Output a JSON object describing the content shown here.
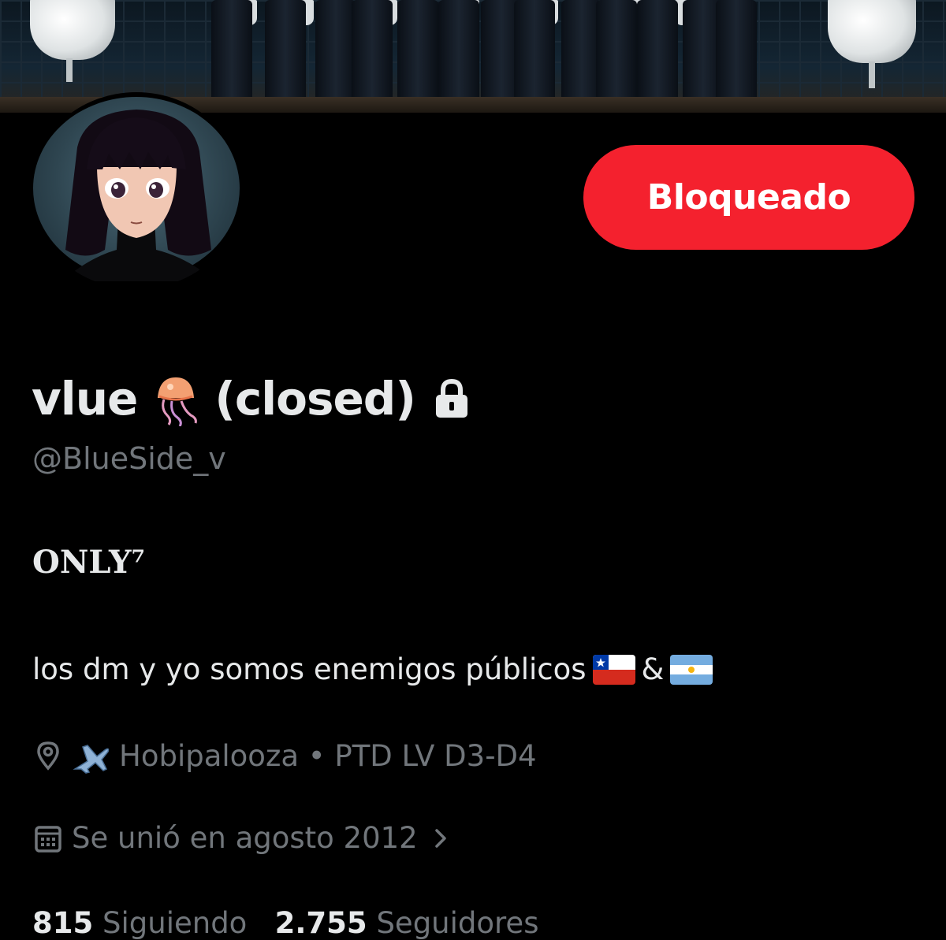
{
  "profile": {
    "display_name": "vlue",
    "display_name_suffix": "(closed)",
    "name_emoji": "jellyfish-icon",
    "handle": "@BlueSide_v",
    "bio_line1": "ONLY⁷",
    "bio_line2": "los dm y yo somos enemigos públicos",
    "bio_ampersand": "&",
    "bio_flags": [
      "chile-flag-icon",
      "argentina-flag-icon"
    ],
    "location_prefix_icon": "airplane-icon",
    "location": "Hobipalooza • PTD LV D3-D4",
    "joined": "Se unió en agosto 2012",
    "following_count": "815",
    "following_label": "Siguiendo",
    "followers_count": "2.755",
    "followers_label": "Seguidores",
    "protected_icon": "lock-icon"
  },
  "actions": {
    "blocked_label": "Bloqueado"
  },
  "colors": {
    "background": "#000000",
    "primary_text": "#e7e9ea",
    "secondary_text": "#71767b",
    "blocked_button": "#f4212e"
  }
}
